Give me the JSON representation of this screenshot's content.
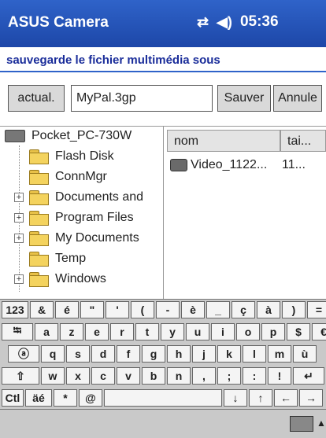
{
  "titlebar": {
    "app_name": "ASUS Camera",
    "time": "05:36",
    "icons": [
      "connectivity-icon",
      "volume-icon"
    ]
  },
  "subtitle": "sauvegarde le fichier multimédia sous",
  "toolbar": {
    "actual_label": "actual.",
    "filename": "MyPal.3gp",
    "save_label": "Sauver",
    "cancel_label": "Annule"
  },
  "tree": {
    "root": "Pocket_PC-730W",
    "items": [
      {
        "label": "Flash Disk",
        "expandable": false
      },
      {
        "label": "ConnMgr",
        "expandable": false
      },
      {
        "label": "Documents and",
        "expandable": true
      },
      {
        "label": "Program Files",
        "expandable": true
      },
      {
        "label": "My Documents",
        "expandable": true
      },
      {
        "label": "Temp",
        "expandable": false
      },
      {
        "label": "Windows",
        "expandable": true
      }
    ]
  },
  "list": {
    "columns": [
      "nom",
      "tai..."
    ],
    "rows": [
      {
        "name": "Video_1122...",
        "size": "11..."
      }
    ]
  },
  "keyboard": {
    "rows": [
      [
        "123",
        "&",
        "é",
        "\"",
        "'",
        "(",
        "-",
        "è",
        "_",
        "ç",
        "à",
        ")",
        "=",
        "⬅"
      ],
      [
        "⭾",
        "a",
        "z",
        "e",
        "r",
        "t",
        "y",
        "u",
        "i",
        "o",
        "p",
        "$",
        "€"
      ],
      [
        "ⓐ",
        "q",
        "s",
        "d",
        "f",
        "g",
        "h",
        "j",
        "k",
        "l",
        "m",
        "ù"
      ],
      [
        "⇧",
        "w",
        "x",
        "c",
        "v",
        "b",
        "n",
        ",",
        ";",
        ":",
        "!",
        "↵"
      ],
      [
        "Ctl",
        "äé",
        "*",
        "@",
        "",
        "↓",
        "↑",
        "←",
        "→"
      ]
    ]
  }
}
